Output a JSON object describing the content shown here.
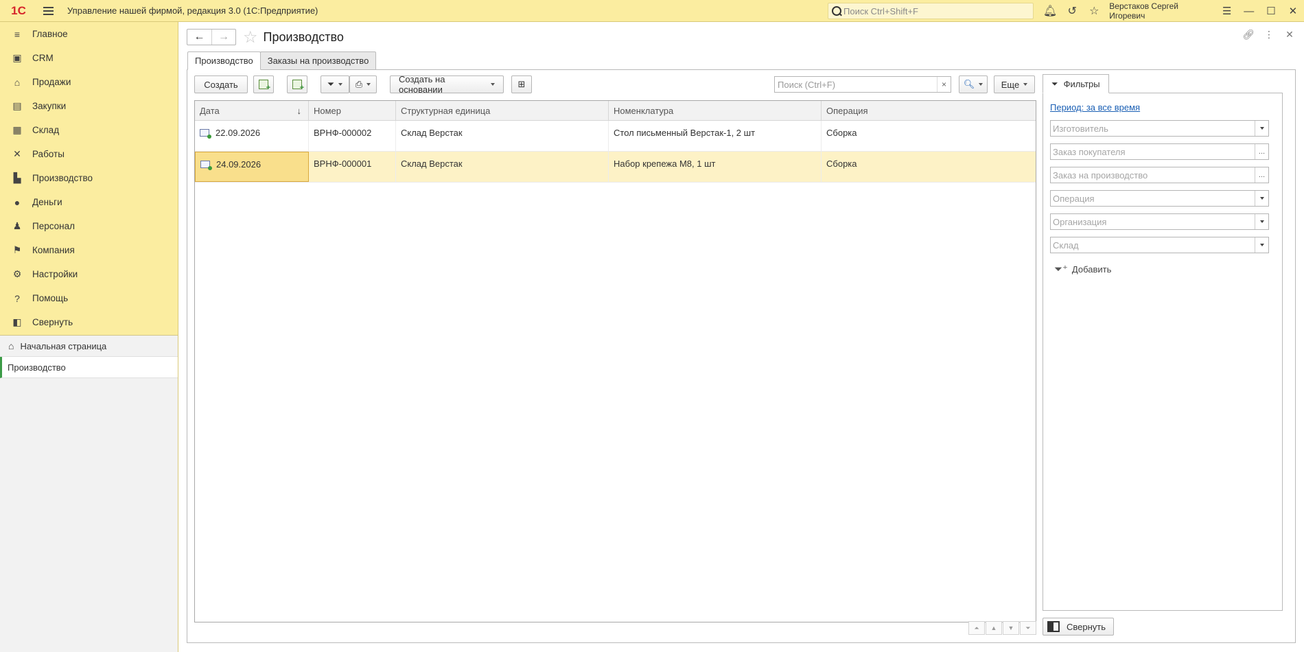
{
  "app": {
    "title": "Управление нашей фирмой, редакция 3.0  (1С:Предприятие)",
    "search_placeholder": "Поиск Ctrl+Shift+F",
    "user": "Верстаков Сергей Игоревич"
  },
  "sidebar": {
    "items": [
      {
        "label": "Главное",
        "icon": "menu-icon"
      },
      {
        "label": "CRM",
        "icon": "crm-icon"
      },
      {
        "label": "Продажи",
        "icon": "sales-icon"
      },
      {
        "label": "Закупки",
        "icon": "purchases-icon"
      },
      {
        "label": "Склад",
        "icon": "warehouse-icon"
      },
      {
        "label": "Работы",
        "icon": "tools-icon"
      },
      {
        "label": "Производство",
        "icon": "factory-icon"
      },
      {
        "label": "Деньги",
        "icon": "money-icon"
      },
      {
        "label": "Персонал",
        "icon": "staff-icon"
      },
      {
        "label": "Компания",
        "icon": "flag-icon"
      },
      {
        "label": "Настройки",
        "icon": "gear-icon"
      },
      {
        "label": "Помощь",
        "icon": "help-icon"
      },
      {
        "label": "Свернуть",
        "icon": "collapse-icon"
      }
    ],
    "open_windows": {
      "home": "Начальная страница",
      "current": "Производство"
    }
  },
  "page": {
    "title": "Производство",
    "tabs": [
      "Производство",
      "Заказы на производство"
    ]
  },
  "toolbar": {
    "create": "Создать",
    "create_based": "Создать на основании",
    "search_placeholder": "Поиск (Ctrl+F)",
    "more": "Еще"
  },
  "table": {
    "columns": [
      "Дата",
      "Номер",
      "Структурная единица",
      "Номенклатура",
      "Операция"
    ],
    "rows": [
      {
        "date": "22.09.2026",
        "number": "ВРНФ-000002",
        "unit": "Склад Верстак",
        "item": "Стол письменный Верстак-1, 2 шт",
        "operation": "Сборка",
        "selected": false
      },
      {
        "date": "24.09.2026",
        "number": "ВРНФ-000001",
        "unit": "Склад Верстак",
        "item": "Набор крепежа М8, 1 шт",
        "operation": "Сборка",
        "selected": true
      }
    ]
  },
  "filters": {
    "tab": "Фильтры",
    "period": "Период: за все время",
    "fields": [
      {
        "placeholder": "Изготовитель",
        "control": "dropdown"
      },
      {
        "placeholder": "Заказ покупателя",
        "control": "choose"
      },
      {
        "placeholder": "Заказ на производство",
        "control": "choose"
      },
      {
        "placeholder": "Операция",
        "control": "dropdown"
      },
      {
        "placeholder": "Организация",
        "control": "dropdown"
      },
      {
        "placeholder": "Склад",
        "control": "dropdown"
      }
    ],
    "add": "Добавить",
    "collapse": "Свернуть"
  }
}
